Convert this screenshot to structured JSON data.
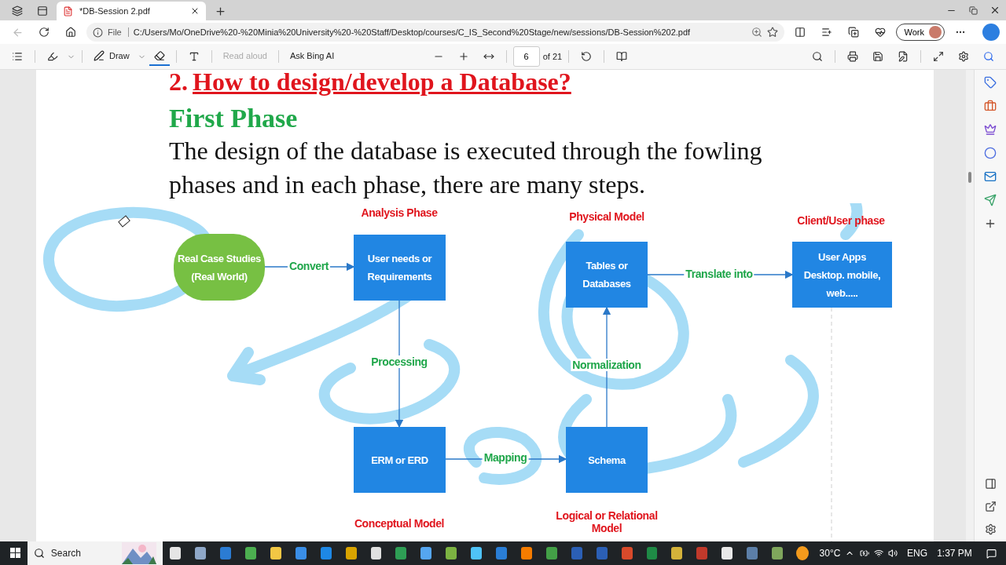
{
  "browser": {
    "tabs": [
      {
        "title": "*DB-Session 2.pdf",
        "selected": true
      }
    ],
    "address": {
      "label": "File",
      "url": "C:/Users/Mo/OneDrive%20-%20Minia%20University%20-%20Staff/Desktop/courses/C_IS_Second%20Stage/new/sessions/DB-Session%202.pdf"
    },
    "profile": "Work"
  },
  "pdf_toolbar": {
    "draw": "Draw",
    "eraser_selected": true,
    "read_aloud": {
      "label": "Read aloud",
      "disabled": true
    },
    "ask": "Ask Bing AI",
    "page": "6",
    "page_count": "of 21"
  },
  "page": {
    "heading_number": "2.",
    "heading": "How to design/develop a Database?",
    "subheading": "First Phase",
    "paragraph": "The design of the database is executed through the fowling phases and in each phase, there are many steps.",
    "diagram": {
      "nodes": [
        {
          "kind": "rounded",
          "lines": [
            "Real Case Studies",
            "(Real World)"
          ]
        },
        {
          "kind": "box",
          "lines": [
            "User needs or",
            "Requirements"
          ]
        },
        {
          "kind": "box",
          "lines": [
            "Tables or",
            "Databases"
          ]
        },
        {
          "kind": "box",
          "lines": [
            "User Apps",
            "Desktop. mobile,",
            "web....."
          ]
        },
        {
          "kind": "box",
          "lines": [
            "ERM or ERD"
          ]
        },
        {
          "kind": "box",
          "lines": [
            "Schema"
          ]
        }
      ],
      "labels": [
        {
          "kind": "phase",
          "text": "Analysis Phase"
        },
        {
          "kind": "phase",
          "text": "Physical Model"
        },
        {
          "kind": "phase",
          "text": "Client/User phase"
        },
        {
          "kind": "phase",
          "text": "Conceptual Model"
        },
        {
          "kind": "phase",
          "text": "Logical or Relational Model"
        },
        {
          "kind": "edge",
          "text": "Convert"
        },
        {
          "kind": "edge",
          "text": "Processing"
        },
        {
          "kind": "edge",
          "text": "Normalization"
        },
        {
          "kind": "edge",
          "text": "Translate into"
        },
        {
          "kind": "edge",
          "text": "Mapping"
        }
      ]
    }
  },
  "taskbar": {
    "search": "Search",
    "temperature": "30°C",
    "language": "ENG",
    "time": "1:37 PM"
  }
}
